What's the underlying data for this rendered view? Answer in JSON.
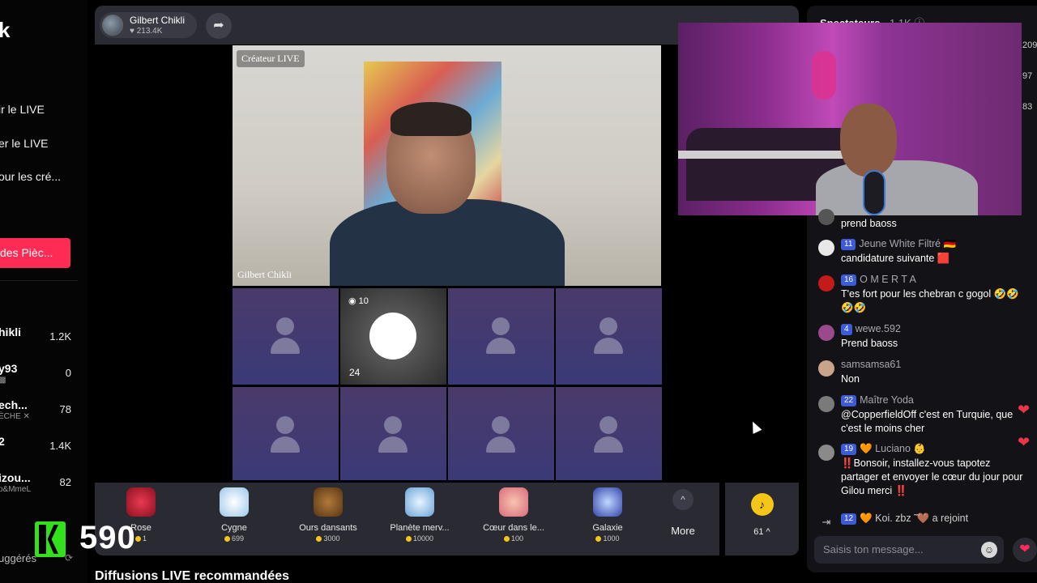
{
  "sidebar": {
    "logo": "k",
    "links": [
      "ir le LIVE",
      "er le LIVE",
      "our les cré..."
    ],
    "coins_button": "des Pièc...",
    "accounts": [
      {
        "name": "hikli",
        "sub": "",
        "count": "1.2K"
      },
      {
        "name": "y93",
        "sub": "▩",
        "count": "0"
      },
      {
        "name": "ech...",
        "sub": "ÈCHE ✕",
        "count": "78"
      },
      {
        "name": "2",
        "sub": "",
        "count": "1.4K"
      },
      {
        "name": "izou...",
        "sub": "o&MmeL",
        "count": "82"
      }
    ],
    "suggested": "uggérés"
  },
  "overlay": {
    "brand_number": "590",
    "brand_color": "#32e01c"
  },
  "live": {
    "host_name": "Gilbert Chikli",
    "host_likes": "♥ 213.4K",
    "creator_tag": "Créateur LIVE",
    "video_name": "Gilbert Chikli",
    "guests": [
      {
        "level": "",
        "count": ""
      },
      {
        "level": "10",
        "count": "24"
      },
      {
        "level": "",
        "count": ""
      },
      {
        "level": "",
        "count": ""
      },
      {
        "level": "",
        "count": ""
      },
      {
        "level": "",
        "count": ""
      },
      {
        "level": "",
        "count": ""
      },
      {
        "level": "",
        "count": ""
      }
    ]
  },
  "gifts": [
    {
      "name": "Rose",
      "price": "1",
      "icon": "rose-icon",
      "color": "#d8243e"
    },
    {
      "name": "Cygne",
      "price": "699",
      "icon": "swan-icon",
      "color": "#cfe6f7"
    },
    {
      "name": "Ours dansants",
      "price": "3000",
      "icon": "bears-icon",
      "color": "#8b5a2b"
    },
    {
      "name": "Planète merv...",
      "price": "10000",
      "icon": "planet-icon",
      "color": "#9ad0f0"
    },
    {
      "name": "Cœur dans le...",
      "price": "100",
      "icon": "heart-hands-icon",
      "color": "#f0a090"
    },
    {
      "name": "Galaxie",
      "price": "1000",
      "icon": "galaxy-icon",
      "color": "#4a6ad0"
    }
  ],
  "more_label": "More",
  "coin_balance": "61 ^",
  "recommended_title": "Diffusions LIVE recommandées",
  "chat": {
    "spectators_label": "Spectateurs",
    "spectators_count": "· 1.1K",
    "side_numbers": [
      "209",
      "97",
      "83"
    ],
    "messages": [
      {
        "badge": "",
        "user": "",
        "text": "prend baoss",
        "avatar": "#666"
      },
      {
        "badge": "11",
        "user": "Jeune White Filtré 🇩🇪",
        "text": "candidature suivante 🟥",
        "avatar": "#e8e8e8"
      },
      {
        "badge": "16",
        "user": "O M E R T A",
        "text": "T'es fort pour les chebran c gogol 🤣🤣🤣🤣",
        "avatar": "#c41a1a"
      },
      {
        "badge": "4",
        "user": "wewe.592",
        "text": "Prend baoss",
        "avatar": "#9a4a8a"
      },
      {
        "badge": "",
        "user": "samsamsa61",
        "text": "Non",
        "avatar": "#c9a38a"
      },
      {
        "badge": "22",
        "user": "Maître Yoda",
        "text": "@CopperfieldOff c'est en Turquie, que c'est le moins cher",
        "avatar": "#7a7a7a"
      },
      {
        "badge": "19",
        "user": "🧡 Luciano 👶",
        "text": "‼️Bonsoir, installez-vous tapotez partager et envoyer le cœur du jour pour Gilou merci ‼️",
        "avatar": "#8a8a8a"
      }
    ],
    "join_badge": "12",
    "join_user": "🧡 Koi. zbz ̃ ̃🤎",
    "join_text": "a rejoint",
    "input_placeholder": "Saisis ton message..."
  }
}
